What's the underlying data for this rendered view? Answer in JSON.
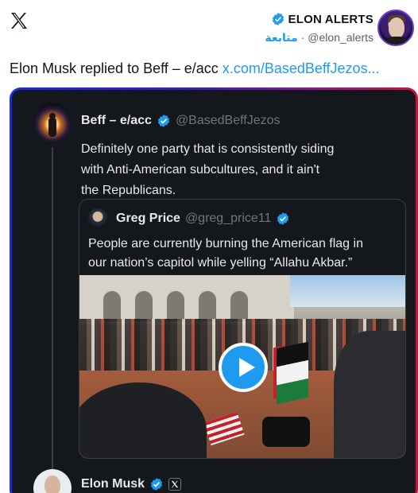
{
  "brand": {
    "logo_icon": "x-logo-icon"
  },
  "author": {
    "name": "ELON ALERTS",
    "handle": "@elon_alerts",
    "separator": "·",
    "follow_label": "متابعة",
    "verified_icon": "verified-badge-icon"
  },
  "tweet": {
    "text": "Elon Musk replied to Beff – e/acc ",
    "link_text": "x.com/BasedBeffJezos..."
  },
  "screenshot": {
    "reply": {
      "name": "Beff – e/acc",
      "handle": "@BasedBeffJezos",
      "lines": [
        "Definitely one party that is consistently siding",
        "with Anti-American subcultures, and it ain't",
        "the Republicans."
      ]
    },
    "quoted": {
      "name": "Greg Price",
      "handle": "@greg_price11",
      "lines": [
        "People are currently burning the American flag in",
        "our nation’s capitol while yelling “Allahu Akbar.”"
      ],
      "media": {
        "type": "video",
        "play_icon": "play-icon"
      }
    },
    "replier": {
      "name": "Elon Musk",
      "badge_icon": "x-affiliate-badge-icon"
    }
  },
  "colors": {
    "accent": "#1d9bf0",
    "dark_bg": "#14171c",
    "border_gradient": [
      "#1c2bd6",
      "#8a1a8c",
      "#c8143e"
    ]
  }
}
